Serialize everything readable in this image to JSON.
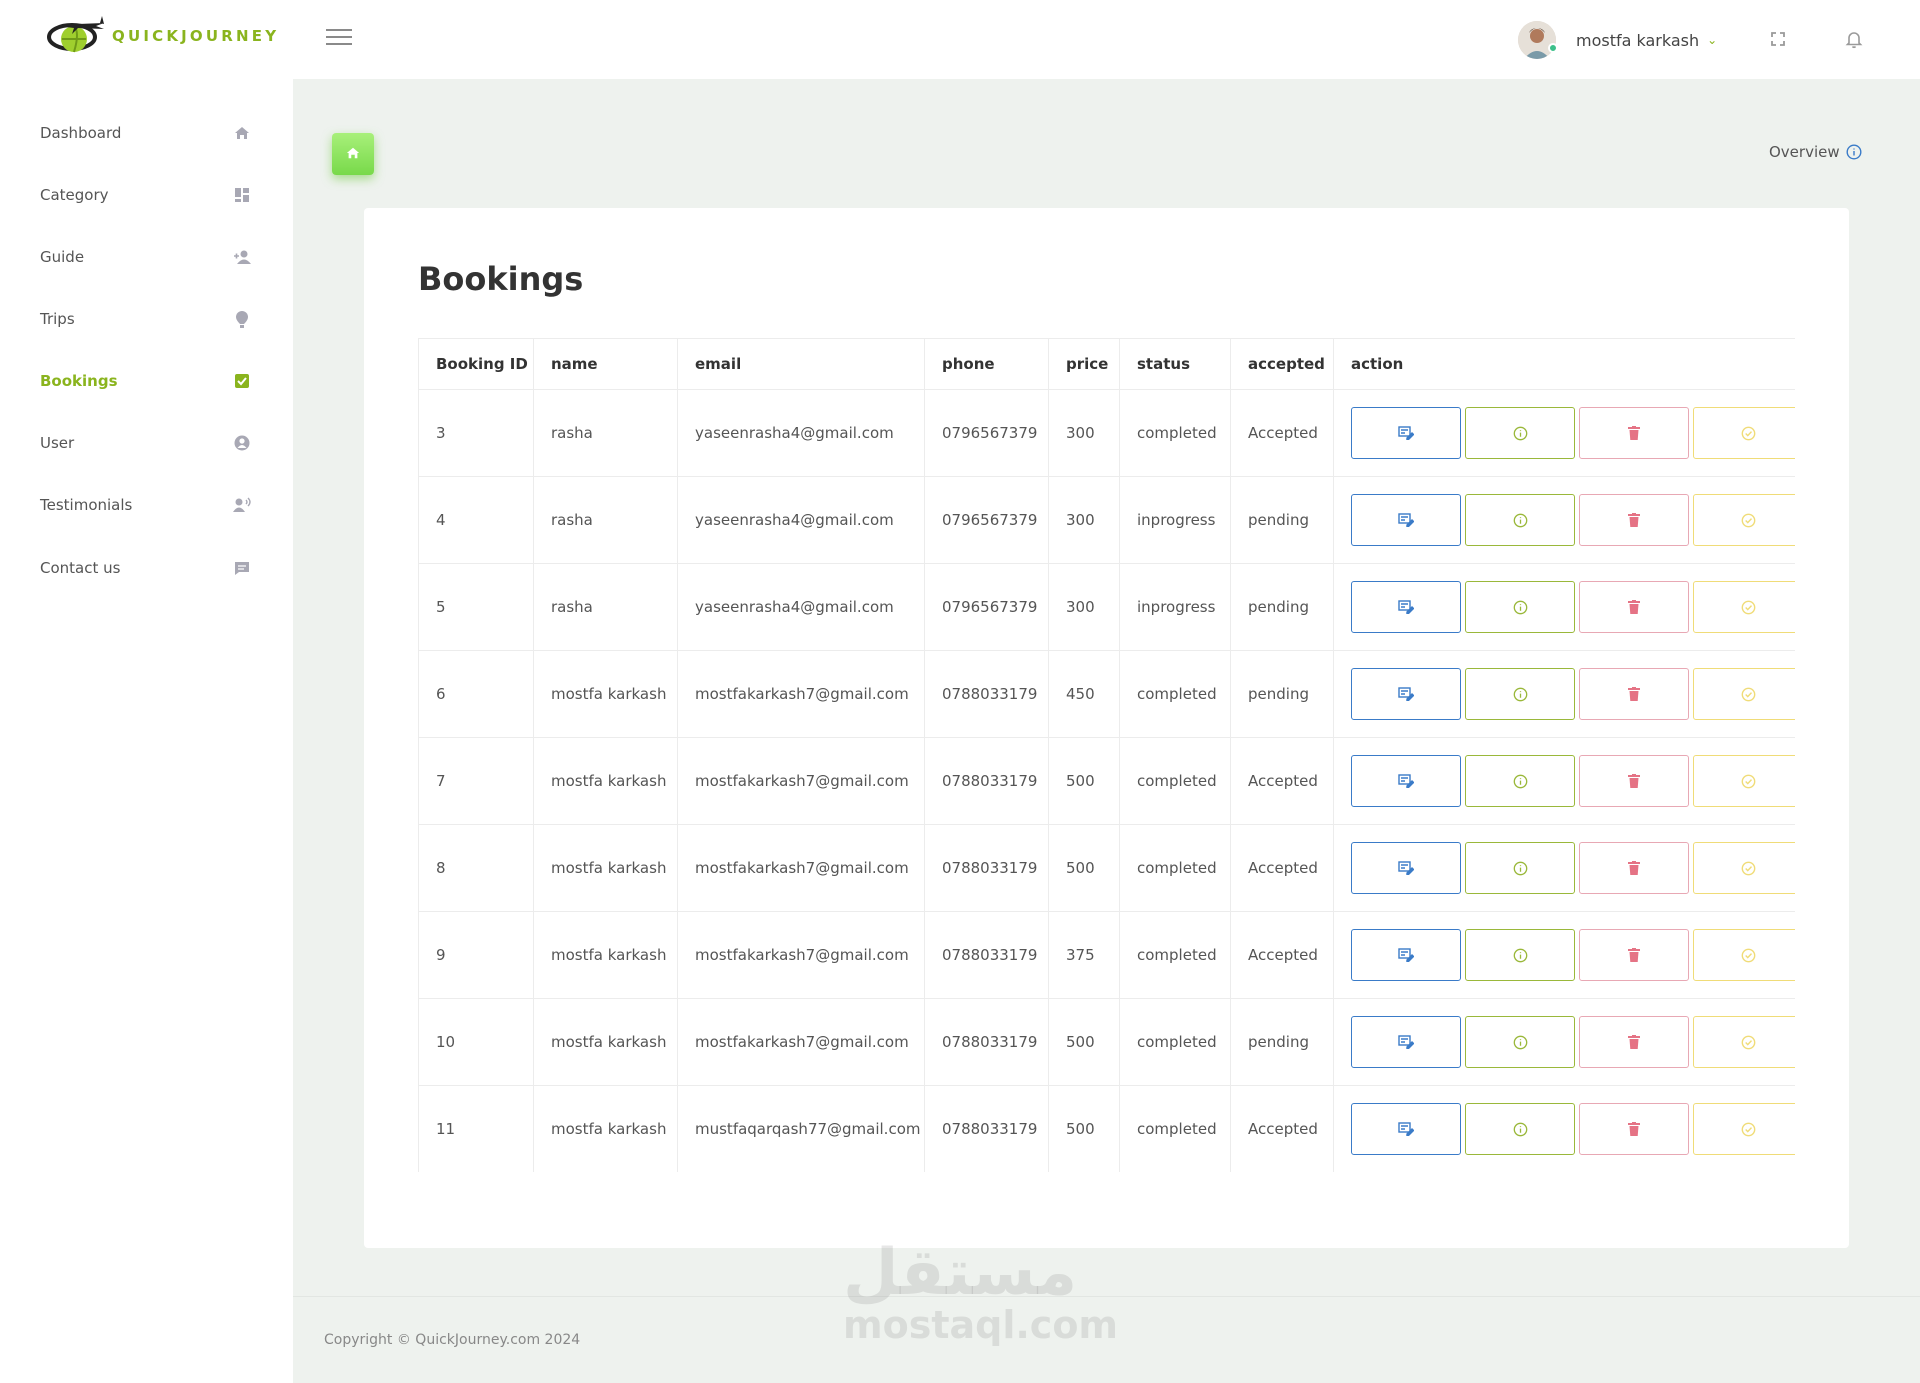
{
  "app": {
    "logo_text": "QUICKJOURNEY"
  },
  "header": {
    "user_name": "mostfa karkash"
  },
  "sidebar": {
    "items": [
      {
        "label": "Dashboard",
        "icon": "home-icon"
      },
      {
        "label": "Category",
        "icon": "dashboard-grid-icon"
      },
      {
        "label": "Guide",
        "icon": "person-add-icon"
      },
      {
        "label": "Trips",
        "icon": "hot-air-balloon-icon"
      },
      {
        "label": "Bookings",
        "icon": "check-box-icon"
      },
      {
        "label": "User",
        "icon": "user-circle-icon"
      },
      {
        "label": "Testimonials",
        "icon": "person-voice-icon"
      },
      {
        "label": "Contact us",
        "icon": "chat-icon"
      }
    ],
    "active": "Bookings"
  },
  "main": {
    "overview_label": "Overview",
    "title": "Bookings",
    "table": {
      "headers": [
        "Booking ID",
        "name",
        "email",
        "phone",
        "price",
        "status",
        "accepted",
        "action"
      ],
      "rows": [
        [
          "3",
          "rasha",
          "yaseenrasha4@gmail.com",
          "0796567379",
          "300",
          "completed",
          "Accepted"
        ],
        [
          "4",
          "rasha",
          "yaseenrasha4@gmail.com",
          "0796567379",
          "300",
          "inprogress",
          "pending"
        ],
        [
          "5",
          "rasha",
          "yaseenrasha4@gmail.com",
          "0796567379",
          "300",
          "inprogress",
          "pending"
        ],
        [
          "6",
          "mostfa karkash",
          "mostfakarkash7@gmail.com",
          "0788033179",
          "450",
          "completed",
          "pending"
        ],
        [
          "7",
          "mostfa karkash",
          "mostfakarkash7@gmail.com",
          "0788033179",
          "500",
          "completed",
          "Accepted"
        ],
        [
          "8",
          "mostfa karkash",
          "mostfakarkash7@gmail.com",
          "0788033179",
          "500",
          "completed",
          "Accepted"
        ],
        [
          "9",
          "mostfa karkash",
          "mostfakarkash7@gmail.com",
          "0788033179",
          "375",
          "completed",
          "Accepted"
        ],
        [
          "10",
          "mostfa karkash",
          "mostfakarkash7@gmail.com",
          "0788033179",
          "500",
          "completed",
          "pending"
        ],
        [
          "11",
          "mostfa karkash",
          "mustfaqarqash77@gmail.com",
          "0788033179",
          "500",
          "completed",
          "Accepted"
        ]
      ],
      "action_icons": [
        "edit-icon",
        "info-icon",
        "trash-icon",
        "check-circle-icon"
      ]
    }
  },
  "footer": {
    "copyright": "Copyright © QuickJourney.com 2024"
  },
  "watermark": {
    "arabic": "مستقل",
    "latin": "mostaql.com"
  },
  "colors": {
    "accent": "#8ab41e",
    "edit": "#3a7bc8",
    "info": "#9ab83a",
    "delete": "#e57385",
    "approve": "#f0dc78"
  }
}
